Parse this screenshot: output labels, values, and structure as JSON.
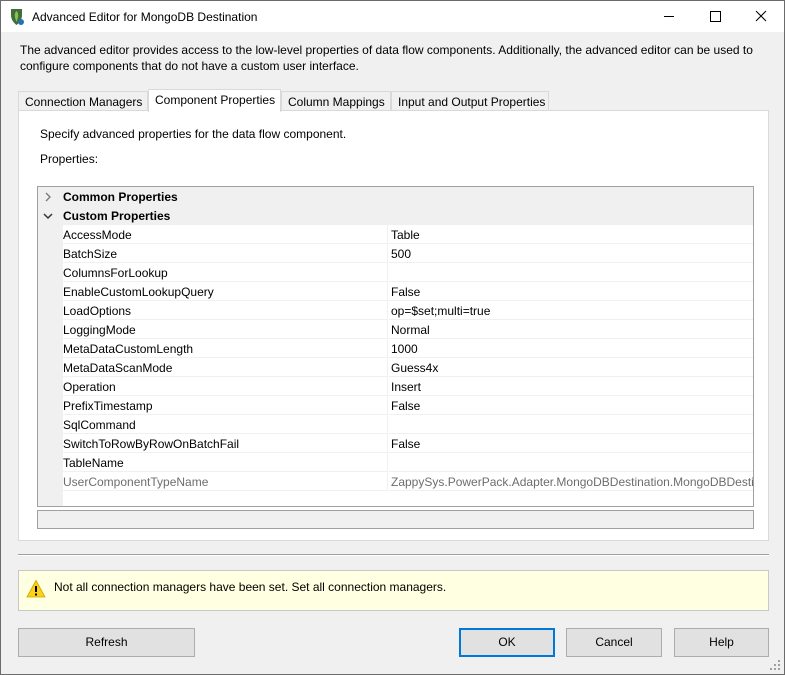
{
  "window": {
    "title": "Advanced Editor for MongoDB Destination",
    "app_icon": "mongodb-leaf-icon",
    "controls": [
      "minimize-icon",
      "maximize-icon",
      "close-icon"
    ]
  },
  "intro_text": "The advanced editor provides access to the low-level properties of data flow components. Additionally, the advanced editor can be used to configure components that do not have a custom user interface.",
  "tabs": [
    {
      "label": "Connection Managers"
    },
    {
      "label": "Component Properties"
    },
    {
      "label": "Column Mappings"
    },
    {
      "label": "Input and Output Properties"
    }
  ],
  "active_tab": "Component Properties",
  "panel": {
    "description": "Specify advanced properties for the data flow component.",
    "properties_label": "Properties:"
  },
  "grid": {
    "categories": [
      {
        "label": "Common Properties",
        "expanded": false,
        "icon": "chevron-right-icon"
      },
      {
        "label": "Custom Properties",
        "expanded": true,
        "icon": "chevron-down-icon"
      }
    ],
    "rows": [
      {
        "name": "AccessMode",
        "value": "Table"
      },
      {
        "name": "BatchSize",
        "value": "500"
      },
      {
        "name": "ColumnsForLookup",
        "value": ""
      },
      {
        "name": "EnableCustomLookupQuery",
        "value": "False"
      },
      {
        "name": "LoadOptions",
        "value": "op=$set;multi=true"
      },
      {
        "name": "LoggingMode",
        "value": "Normal"
      },
      {
        "name": "MetaDataCustomLength",
        "value": "1000"
      },
      {
        "name": "MetaDataScanMode",
        "value": "Guess4x"
      },
      {
        "name": "Operation",
        "value": "Insert"
      },
      {
        "name": "PrefixTimestamp",
        "value": "False"
      },
      {
        "name": "SqlCommand",
        "value": ""
      },
      {
        "name": "SwitchToRowByRowOnBatchFail",
        "value": "False"
      },
      {
        "name": "TableName",
        "value": ""
      },
      {
        "name": "UserComponentTypeName",
        "value": "ZappySys.PowerPack.Adapter.MongoDBDestination.MongoDBDestination",
        "readonly": true
      }
    ]
  },
  "warning": {
    "icon": "warning-icon",
    "text": "Not all connection managers have been set. Set all connection managers."
  },
  "buttons": {
    "refresh": "Refresh",
    "ok": "OK",
    "cancel": "Cancel",
    "help": "Help"
  },
  "colors": {
    "accent": "#0078d7",
    "warning_bg": "#ffffe1",
    "category_bg": "#f0f0f0"
  }
}
